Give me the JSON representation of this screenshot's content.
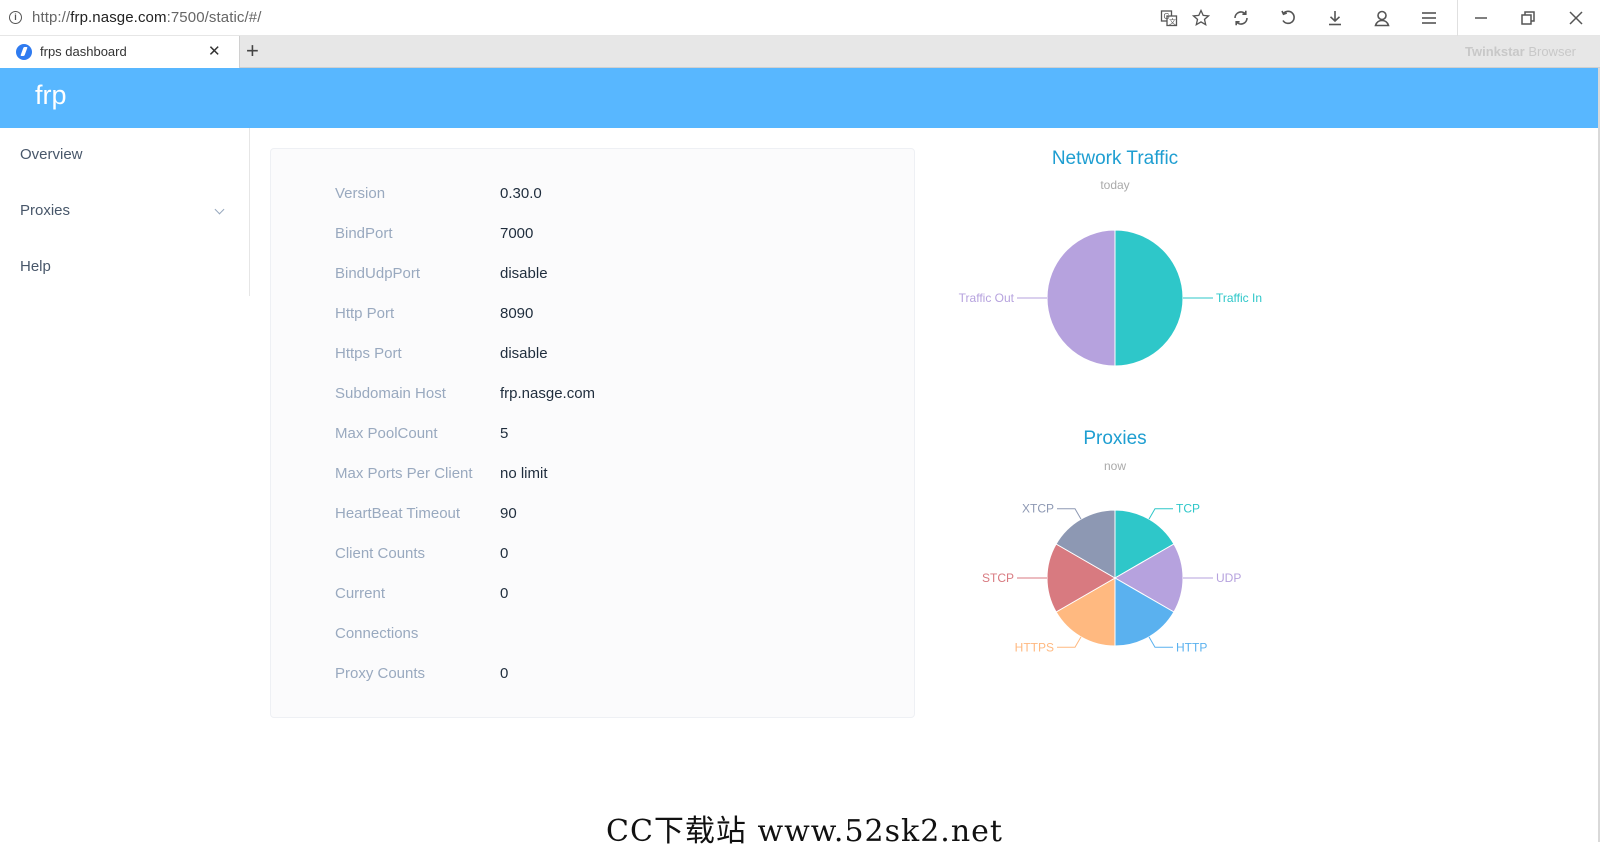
{
  "browser": {
    "url_prefix": "http://",
    "url_host": "frp.nasge.com",
    "url_rest": ":7500/static/#/",
    "tab_title": "frps dashboard",
    "new_tab": "+",
    "brand_bold": "Twinkstar",
    "brand_rest": " Browser"
  },
  "header": {
    "logo": "frp"
  },
  "sidebar": {
    "items": [
      {
        "label": "Overview"
      },
      {
        "label": "Proxies"
      },
      {
        "label": "Help"
      }
    ]
  },
  "info": {
    "rows": [
      {
        "key": "Version",
        "value": "0.30.0"
      },
      {
        "key": "BindPort",
        "value": "7000"
      },
      {
        "key": "BindUdpPort",
        "value": "disable"
      },
      {
        "key": "Http Port",
        "value": "8090"
      },
      {
        "key": "Https Port",
        "value": "disable"
      },
      {
        "key": "Subdomain Host",
        "value": "frp.nasge.com"
      },
      {
        "key": "Max PoolCount",
        "value": "5"
      },
      {
        "key": "Max Ports Per Client",
        "value": "no limit"
      },
      {
        "key": "HeartBeat Timeout",
        "value": "90"
      },
      {
        "key": "Client Counts",
        "value": "0"
      },
      {
        "key": "Current",
        "value": "0"
      },
      {
        "key": "Connections",
        "value": ""
      },
      {
        "key": "Proxy Counts",
        "value": "0"
      }
    ]
  },
  "chart_data": [
    {
      "type": "pie",
      "title": "Network Traffic",
      "subtitle": "today",
      "slices": [
        {
          "name": "Traffic In",
          "value": 1,
          "color": "#2ec7c9"
        },
        {
          "name": "Traffic Out",
          "value": 1,
          "color": "#b6a2de"
        }
      ]
    },
    {
      "type": "pie",
      "title": "Proxies",
      "subtitle": "now",
      "slices": [
        {
          "name": "TCP",
          "value": 1,
          "color": "#2ec7c9"
        },
        {
          "name": "UDP",
          "value": 1,
          "color": "#b6a2de"
        },
        {
          "name": "HTTP",
          "value": 1,
          "color": "#5ab1ef"
        },
        {
          "name": "HTTPS",
          "value": 1,
          "color": "#ffb980"
        },
        {
          "name": "STCP",
          "value": 1,
          "color": "#d87a80"
        },
        {
          "name": "XTCP",
          "value": 1,
          "color": "#8d98b3"
        }
      ]
    }
  ],
  "watermark": "CC下载站 www.52sk2.net"
}
